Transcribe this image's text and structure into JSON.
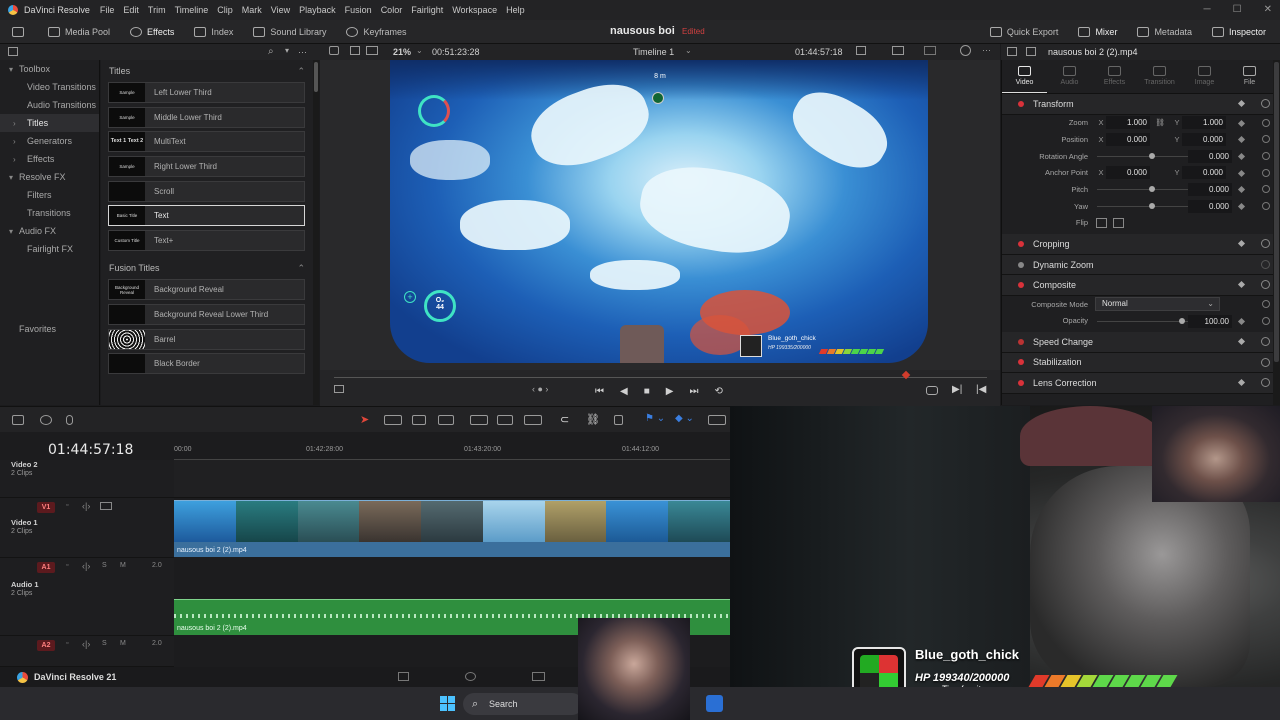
{
  "app": {
    "title": "DaVinci Resolve",
    "menu": [
      "File",
      "Edit",
      "Trim",
      "Timeline",
      "Clip",
      "Mark",
      "View",
      "Playback",
      "Fusion",
      "Color",
      "Fairlight",
      "Workspace",
      "Help"
    ],
    "footer_label": "DaVinci Resolve 21"
  },
  "toolbar": {
    "left": [
      "Media Pool",
      "Effects",
      "Index",
      "Sound Library",
      "Keyframes"
    ],
    "project_title": "nausous boi",
    "project_status": "Edited",
    "right": [
      "Quick Export",
      "Mixer",
      "Metadata",
      "Inspector"
    ]
  },
  "fx_tree": {
    "items": [
      {
        "label": "Toolbox",
        "level": 0,
        "arrow": "▾"
      },
      {
        "label": "Video Transitions",
        "level": 1
      },
      {
        "label": "Audio Transitions",
        "level": 1
      },
      {
        "label": "Titles",
        "level": 1,
        "arrow": "›",
        "selected": true
      },
      {
        "label": "Generators",
        "level": 1,
        "arrow": "›"
      },
      {
        "label": "Effects",
        "level": 1,
        "arrow": "›"
      },
      {
        "label": "Resolve FX",
        "level": 0,
        "arrow": "▾"
      },
      {
        "label": "Filters",
        "level": 1
      },
      {
        "label": "Transitions",
        "level": 1
      },
      {
        "label": "Audio FX",
        "level": 0,
        "arrow": "▾"
      },
      {
        "label": "Fairlight FX",
        "level": 1
      }
    ],
    "favorites": "Favorites"
  },
  "fx_list": {
    "titles_header": "Titles",
    "titles": [
      {
        "label": "Left Lower Third",
        "thumb": "Sample"
      },
      {
        "label": "Middle Lower Third",
        "thumb": "Sample"
      },
      {
        "label": "MultiText",
        "thumb": "Text 1 Text 2"
      },
      {
        "label": "Right Lower Third",
        "thumb": "Sample"
      },
      {
        "label": "Scroll",
        "thumb": ""
      },
      {
        "label": "Text",
        "thumb": "Basic Title",
        "selected": true
      },
      {
        "label": "Text+",
        "thumb": "Custom Title"
      }
    ],
    "fusion_header": "Fusion Titles",
    "fusion": [
      {
        "label": "Background Reveal",
        "thumb": "Background Reveal"
      },
      {
        "label": "Background Reveal Lower Third",
        "thumb": ""
      },
      {
        "label": "Barrel",
        "thumb": ""
      },
      {
        "label": "Black Border",
        "thumb": ""
      }
    ]
  },
  "viewer": {
    "zoom": "21%",
    "duration": "00:51:23:28",
    "timeline_name": "Timeline 1",
    "timecode": "01:44:57:18",
    "hud": {
      "o2_label": "O₂",
      "o2_value": "44",
      "depth": "8 m",
      "streamer_name": "Blue_goth_chick",
      "streamer_hp": "HP 199335/200000"
    }
  },
  "inspector": {
    "clip_name": "nausous boi 2 (2).mp4",
    "tabs": [
      "Video",
      "Audio",
      "Effects",
      "Transition",
      "Image",
      "File"
    ],
    "active_tab": "Video",
    "transform_title": "Transform",
    "params": [
      {
        "label": "Zoom",
        "x_label": "X",
        "x": "1.000",
        "y_label": "Y",
        "y": "1.000"
      },
      {
        "label": "Position",
        "x_label": "X",
        "x": "0.000",
        "y_label": "Y",
        "y": "0.000"
      },
      {
        "label": "Rotation Angle",
        "slider": 0.5,
        "value": "0.000"
      },
      {
        "label": "Anchor Point",
        "x_label": "X",
        "x": "0.000",
        "y_label": "Y",
        "y": "0.000"
      },
      {
        "label": "Pitch",
        "slider": 0.5,
        "value": "0.000"
      },
      {
        "label": "Yaw",
        "slider": 0.5,
        "value": "0.000"
      },
      {
        "label": "Flip"
      }
    ],
    "cropping": "Cropping",
    "dynamic_zoom": "Dynamic Zoom",
    "composite": "Composite",
    "composite_mode_label": "Composite Mode",
    "composite_mode": "Normal",
    "opacity_label": "Opacity",
    "opacity": "100.00",
    "speed_change": "Speed Change",
    "stabilization": "Stabilization",
    "lens_correction": "Lens Correction"
  },
  "timeline": {
    "timecode": "01:44:57:18",
    "ruler": [
      "00:00",
      "01:42:28:00",
      "01:43:20:00",
      "01:44:12:00"
    ],
    "tracks": [
      {
        "name": "Video 2",
        "clips": "2 Clips"
      },
      {
        "name": "Video 1",
        "badge": "V1",
        "clips": "2 Clips"
      },
      {
        "name": "Audio 1",
        "badge": "A1",
        "clips": "2 Clips",
        "level": "2.0"
      },
      {
        "badge": "A2",
        "level": "2.0"
      }
    ],
    "video_clip_name": "nausous boi 2 (2).mp4",
    "audio_clip_name": "nausous boi 2 (2).mp4",
    "solo": "S",
    "mute": "M"
  },
  "overlay": {
    "streamer_name": "Blue_goth_chick",
    "hp": "HP 199340/200000",
    "subtext": "Tiny furnit"
  },
  "taskbar": {
    "search_placeholder": "Search"
  },
  "colors": {
    "accent_red": "#d9323a",
    "video_clip": "#3b6f9c",
    "audio_clip": "#2f8f3e",
    "hud_teal": "#3fe3c4"
  }
}
